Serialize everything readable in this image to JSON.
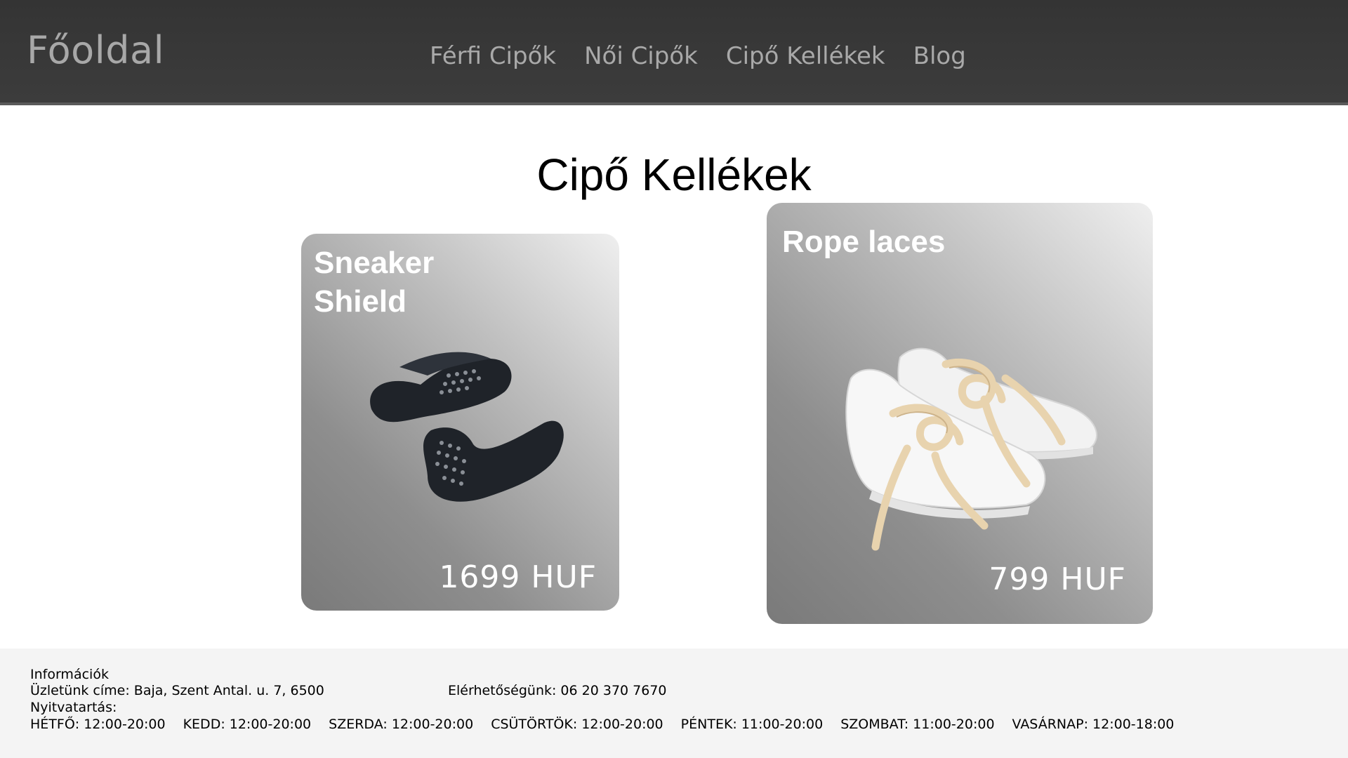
{
  "header": {
    "brand": "Főoldal",
    "nav": [
      {
        "label": "Férfi Cipők"
      },
      {
        "label": "Női Cipők"
      },
      {
        "label": "Cipő Kellékek"
      },
      {
        "label": "Blog"
      }
    ]
  },
  "main": {
    "title": "Cipő Kellékek",
    "products": [
      {
        "name": "Sneaker Shield",
        "price": "1699 HUF"
      },
      {
        "name": "Rope laces",
        "price": "799 HUF"
      }
    ]
  },
  "footer": {
    "heading": "Információk",
    "address": "Üzletünk címe: Baja, Szent Antal. u. 7, 6500",
    "contact": "Elérhetőségünk: 06 20 370 7670",
    "hours_label": "Nyitvatartás:",
    "hours": [
      "HÉTFŐ: 12:00-20:00",
      "KEDD: 12:00-20:00",
      "SZERDA: 12:00-20:00",
      "CSÜTÖRTÖK: 12:00-20:00",
      "PÉNTEK: 11:00-20:00",
      "SZOMBAT: 11:00-20:00",
      "VASÁRNAP: 12:00-18:00"
    ]
  }
}
